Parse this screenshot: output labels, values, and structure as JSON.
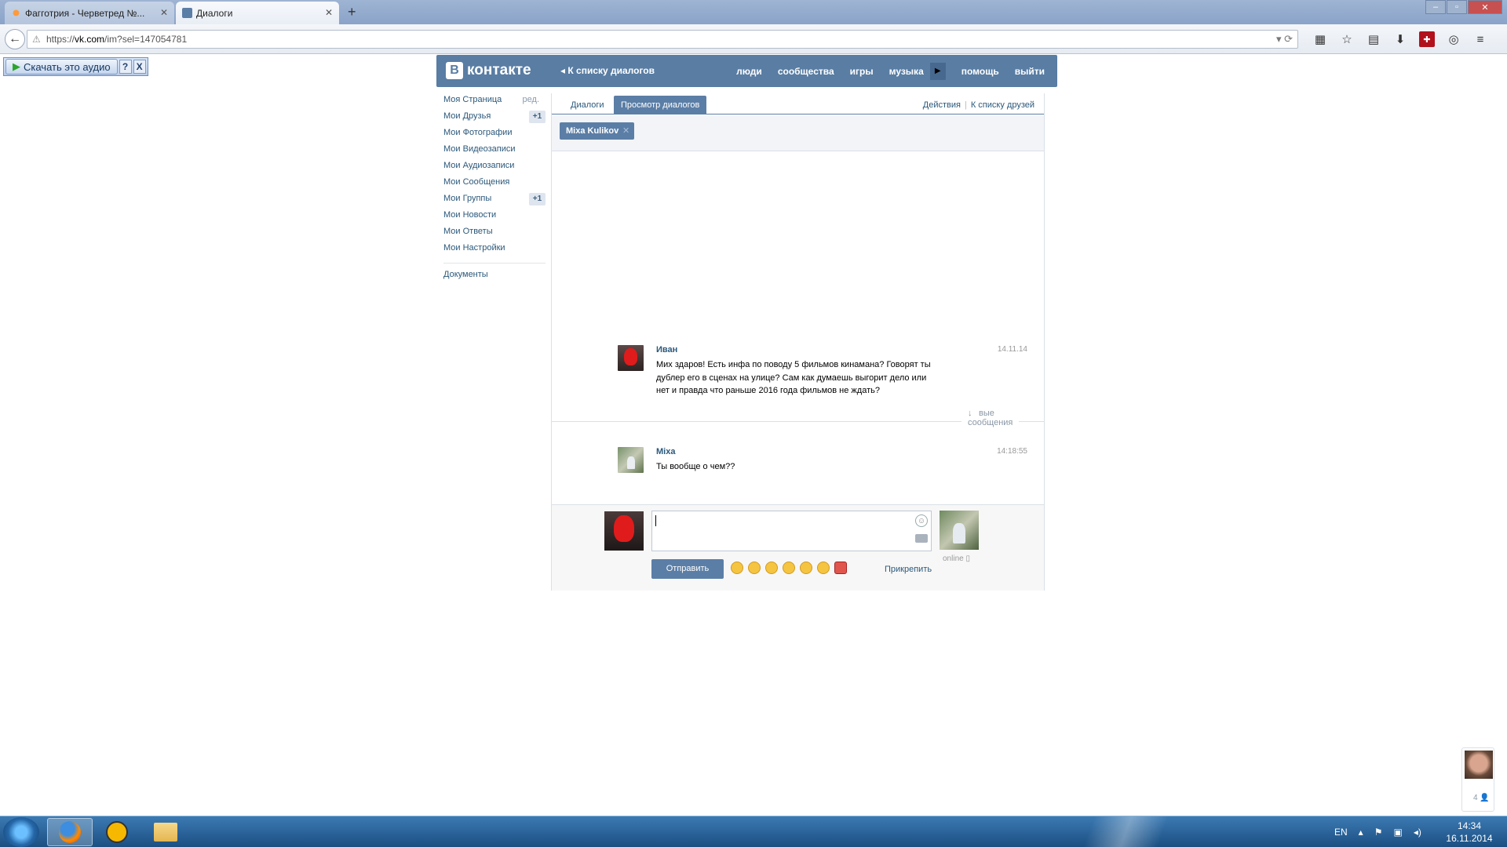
{
  "browser": {
    "tabs": [
      {
        "title": "Фагготрия - Черветред №...",
        "active": false
      },
      {
        "title": "Диалоги",
        "active": true
      }
    ],
    "new_tab": "+",
    "url_prefix": "https://",
    "url_domain": "vk.com",
    "url_path": "/im?sel=147054781"
  },
  "addon": {
    "download_label": "Скачать это аудио",
    "help": "?",
    "close": "X"
  },
  "vk": {
    "logo": "контакте",
    "logo_letter": "В",
    "back_to_dialogs": "К списку диалогов",
    "nav": [
      "люди",
      "сообщества",
      "игры",
      "музыка",
      "помощь",
      "выйти"
    ],
    "colors": {
      "brand": "#597da3",
      "link": "#2b587a"
    }
  },
  "menu": {
    "items": [
      {
        "label": "Моя Страница",
        "extra": "ред."
      },
      {
        "label": "Мои Друзья",
        "badge": "+1"
      },
      {
        "label": "Мои Фотографии"
      },
      {
        "label": "Мои Видеозаписи"
      },
      {
        "label": "Мои Аудиозаписи"
      },
      {
        "label": "Мои Сообщения"
      },
      {
        "label": "Мои Группы",
        "badge": "+1"
      },
      {
        "label": "Мои Новости"
      },
      {
        "label": "Мои Ответы"
      },
      {
        "label": "Мои Настройки"
      }
    ],
    "docs": "Документы"
  },
  "dialog": {
    "tab_dialogs": "Диалоги",
    "tab_view": "Просмотр диалогов",
    "actions": "Действия",
    "friends_list": "К списку друзей",
    "peer_name": "Mixa Kulikov",
    "messages": [
      {
        "author": "Иван",
        "time": "14.11.14",
        "text": "Мих здаров! Есть инфа по поводу 5 фильмов кинамана? Говорят ты дублер его в сценах на улице? Сам как думаешь выгорит дело или нет и правда что раньше 2016 года фильмов не ждать?"
      },
      {
        "author": "Mixa",
        "time": "14:18:55",
        "text": "Ты вообще о чем??"
      }
    ],
    "new_messages": "Новые сообщения",
    "send": "Отправить",
    "attach": "Прикрепить",
    "online": "online"
  },
  "widget": {
    "count": "4"
  },
  "taskbar": {
    "lang": "EN",
    "time": "14:34",
    "date": "16.11.2014"
  }
}
